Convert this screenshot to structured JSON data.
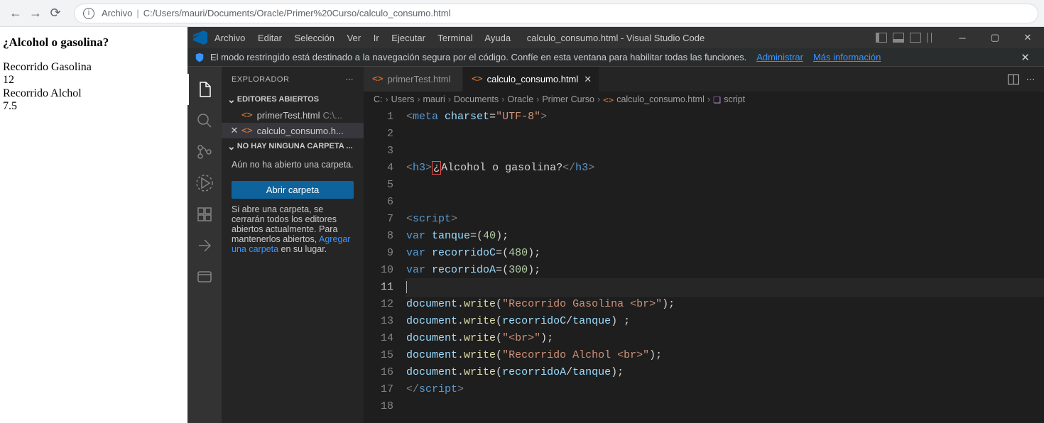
{
  "browser": {
    "addr_prefix": "Archivo",
    "addr_path": "C:/Users/mauri/Documents/Oracle/Primer%20Curso/calculo_consumo.html"
  },
  "page": {
    "title": "¿Alcohol o gasolina?",
    "l1": "Recorrido Gasolina",
    "l2": "12",
    "l3": "Recorrido Alchol",
    "l4": "7.5"
  },
  "vscode": {
    "menu": [
      "Archivo",
      "Editar",
      "Selección",
      "Ver",
      "Ir",
      "Ejecutar",
      "Terminal",
      "Ayuda"
    ],
    "window_title": "calculo_consumo.html - Visual Studio Code",
    "infobar": {
      "msg": "El modo restringido está destinado a la navegación segura por el código. Confíe en esta ventana para habilitar todas las funciones.",
      "link1": "Administrar",
      "link2": "Más información"
    },
    "sidebar": {
      "title": "EXPLORADOR",
      "open_editors": "EDITORES ABIERTOS",
      "file1": "primerTest.html",
      "file1_suffix": " C:\\...",
      "file2": "calculo_consumo.h...",
      "no_folder_section": "NO HAY NINGUNA CARPETA ...",
      "no_folder_msg": "Aún no ha abierto una carpeta.",
      "open_btn": "Abrir carpeta",
      "hint_a": "Si abre una carpeta, se cerrarán todos los editores abiertos actualmente. Para mantenerlos abiertos, ",
      "hint_link": "Agregar una carpeta",
      "hint_b": " en su lugar."
    },
    "tabs": {
      "t1": "primerTest.html",
      "t2": "calculo_consumo.html"
    },
    "crumbs": [
      "C:",
      "Users",
      "mauri",
      "Documents",
      "Oracle",
      "Primer Curso",
      "calculo_consumo.html",
      "script"
    ],
    "line_numbers": [
      "1",
      "2",
      "3",
      "4",
      "5",
      "6",
      "7",
      "8",
      "9",
      "10",
      "11",
      "12",
      "13",
      "14",
      "15",
      "16",
      "17",
      "18"
    ],
    "code": {
      "l1_tag_open": "<",
      "l1_tag": "meta",
      "l1_attr": " charset",
      "l1_eq": "=",
      "l1_str": "\"UTF-8\"",
      "l1_tag_close": ">",
      "l4_open": "<",
      "l4_tag": "h3",
      "l4_c1": ">",
      "l4_err": "¿",
      "l4_text": "Alcohol o gasolina?",
      "l4_close_open": "</",
      "l4_close_tag": "h3",
      "l4_close": ">",
      "l7_open": "<",
      "l7_tag": "script",
      "l7_close": ">",
      "l8_kw": "var",
      "l8_var": " tanque",
      "l8_eq": "=",
      "l8_p1": "(",
      "l8_num": "40",
      "l8_p2": ")",
      "l8_semi": ";",
      "l9_kw": "var",
      "l9_var": " recorridoC",
      "l9_eq": "=",
      "l9_p1": "(",
      "l9_num": "480",
      "l9_p2": ")",
      "l9_semi": ";",
      "l10_kw": "var",
      "l10_var": " recorridoA",
      "l10_eq": "=",
      "l10_p1": "(",
      "l10_num": "300",
      "l10_p2": ")",
      "l10_semi": ";",
      "l12_obj": "document",
      "l12_dot": ".",
      "l12_fn": "write",
      "l12_p1": "(",
      "l12_str": "\"Recorrido Gasolina <br>\"",
      "l12_p2": ")",
      "l12_semi": ";",
      "l13_obj": "document",
      "l13_dot": ".",
      "l13_fn": "write",
      "l13_p1": "(",
      "l13_a": "recorridoC",
      "l13_op": "/",
      "l13_b": "tanque",
      "l13_p2": ")",
      "l13_sp": " ",
      "l13_semi": ";",
      "l14_obj": "document",
      "l14_dot": ".",
      "l14_fn": "write",
      "l14_p1": "(",
      "l14_str": "\"<br>\"",
      "l14_p2": ")",
      "l14_semi": ";",
      "l15_obj": "document",
      "l15_dot": ".",
      "l15_fn": "write",
      "l15_p1": "(",
      "l15_str": "\"Recorrido Alchol <br>\"",
      "l15_p2": ")",
      "l15_semi": ";",
      "l16_obj": "document",
      "l16_dot": ".",
      "l16_fn": "write",
      "l16_p1": "(",
      "l16_a": "recorridoA",
      "l16_op": "/",
      "l16_b": "tanque",
      "l16_p2": ")",
      "l16_semi": ";",
      "l17_open": "</",
      "l17_tag": "script",
      "l17_close": ">"
    }
  }
}
